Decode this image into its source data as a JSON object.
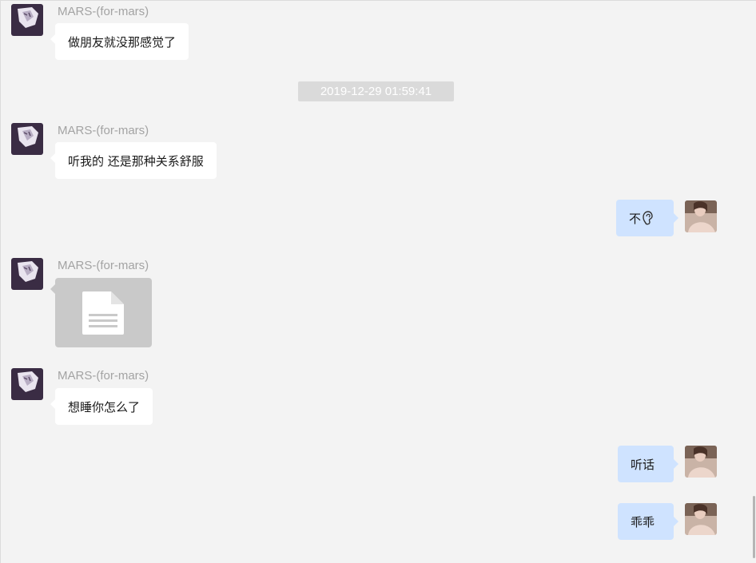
{
  "colors": {
    "background": "#f3f3f3",
    "incoming_bubble": "#ffffff",
    "outgoing_bubble": "#cfe3ff",
    "sender_name": "#a3a3a3",
    "timestamp_bg": "#dadada",
    "file_bubble": "#c9c9c9"
  },
  "timestamp": "2019-12-29 01:59:41",
  "messages": [
    {
      "direction": "incoming",
      "sender": "MARS-(for-mars)",
      "text": "做朋友就没那感觉了"
    },
    {
      "direction": "incoming",
      "sender": "MARS-(for-mars)",
      "text": "听我的 还是那种关系舒服"
    },
    {
      "direction": "outgoing",
      "text": "不",
      "emoji": "ear-emoji"
    },
    {
      "direction": "incoming",
      "sender": "MARS-(for-mars)",
      "attachment": "file-icon"
    },
    {
      "direction": "incoming",
      "sender": "MARS-(for-mars)",
      "text": "想睡你怎么了"
    },
    {
      "direction": "outgoing",
      "text": "听话"
    },
    {
      "direction": "outgoing",
      "text": "乖乖"
    }
  ]
}
